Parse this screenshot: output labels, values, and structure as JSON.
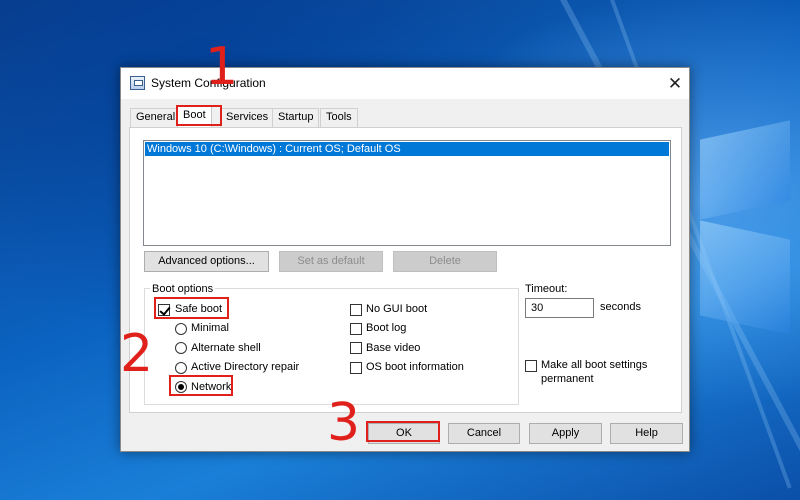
{
  "window": {
    "title": "System Configuration",
    "close_glyph": "✕"
  },
  "tabs": [
    {
      "label": "General",
      "active": false
    },
    {
      "label": "Boot",
      "active": true
    },
    {
      "label": "Services",
      "active": false
    },
    {
      "label": "Startup",
      "active": false
    },
    {
      "label": "Tools",
      "active": false
    }
  ],
  "os_list": {
    "items": [
      "Windows 10 (C:\\Windows) : Current OS; Default OS"
    ]
  },
  "buttons": {
    "advanced_options": "Advanced options...",
    "set_as_default": "Set as default",
    "delete": "Delete",
    "ok": "OK",
    "cancel": "Cancel",
    "apply": "Apply",
    "help": "Help"
  },
  "boot_options": {
    "group_label": "Boot options",
    "safe_boot": {
      "label": "Safe boot",
      "checked": true
    },
    "radios": [
      {
        "label": "Minimal",
        "checked": false
      },
      {
        "label": "Alternate shell",
        "checked": false
      },
      {
        "label": "Active Directory repair",
        "checked": false
      },
      {
        "label": "Network",
        "checked": true
      }
    ],
    "checks": [
      {
        "label": "No GUI boot",
        "checked": false
      },
      {
        "label": "Boot log",
        "checked": false
      },
      {
        "label": "Base video",
        "checked": false
      },
      {
        "label": "OS boot information",
        "checked": false
      }
    ]
  },
  "timeout": {
    "label": "Timeout:",
    "value": "30",
    "unit": "seconds"
  },
  "permanent": {
    "label_line1": "Make all boot settings",
    "label_line2": "permanent",
    "checked": false
  },
  "annotations": {
    "step1": "1",
    "step2": "2",
    "step3": "3",
    "color": "#e0201b"
  }
}
